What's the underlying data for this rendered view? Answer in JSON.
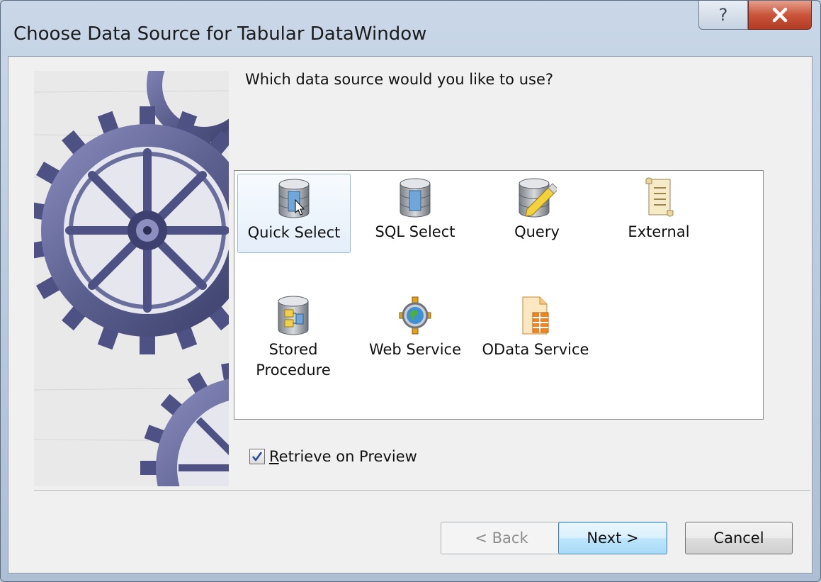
{
  "window": {
    "title": "Choose Data Source for Tabular DataWindow"
  },
  "titlebar": {
    "help_icon": "question-mark-icon",
    "close_icon": "close-x-icon"
  },
  "prompt": "Which data source would you like to use?",
  "sources": [
    {
      "label": "Quick Select",
      "icon": "database-cursor-icon",
      "selected": true
    },
    {
      "label": "SQL Select",
      "icon": "database-icon",
      "selected": false
    },
    {
      "label": "Query",
      "icon": "database-pencil-icon",
      "selected": false
    },
    {
      "label": "External",
      "icon": "scroll-document-icon",
      "selected": false
    },
    {
      "label": "Stored\nProcedure",
      "icon": "database-procedure-icon",
      "selected": false
    },
    {
      "label": "Web Service",
      "icon": "globe-gear-icon",
      "selected": false
    },
    {
      "label": "OData Service",
      "icon": "orange-document-icon",
      "selected": false
    }
  ],
  "retrieve": {
    "label_prefix": "R",
    "label_rest": "etrieve on Preview",
    "checked": true
  },
  "buttons": {
    "back": "< Back",
    "next": "Next >",
    "cancel": "Cancel"
  },
  "colors": {
    "accent": "#3c7fb1",
    "close_red": "#c9553c",
    "gear": "#5b5f8e"
  }
}
